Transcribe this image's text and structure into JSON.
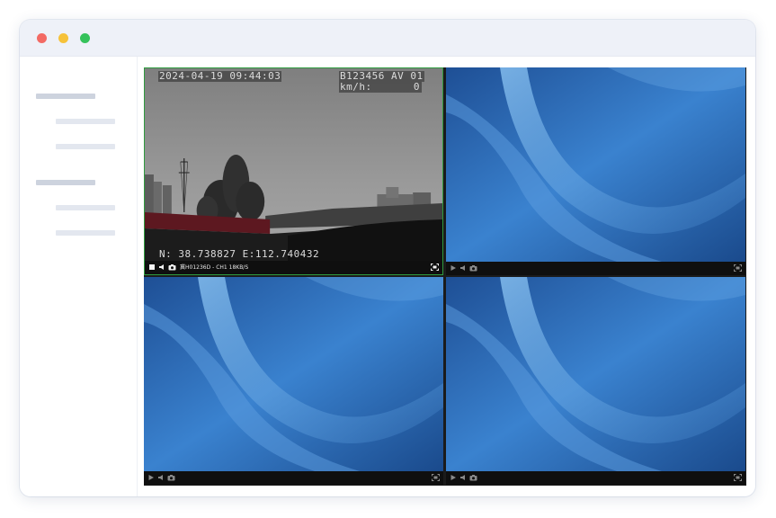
{
  "window": {
    "controls": [
      "close",
      "minimize",
      "maximize"
    ]
  },
  "video_panels": [
    {
      "state": "live",
      "osd": {
        "timestamp": "2024-04-19 09:44:03",
        "plate_channel": "B123456 AV 01",
        "speed_label": "km/h:",
        "speed_value": "0",
        "gps": "N: 38.738827 E:112.740432"
      },
      "status_label": "冀H01236D - CH1 18KB/S",
      "icons": [
        "stop-icon",
        "volume-icon",
        "camera-icon",
        "fullscreen-icon"
      ]
    },
    {
      "state": "idle",
      "icons": [
        "play-icon",
        "volume-icon",
        "camera-icon",
        "fullscreen-icon"
      ]
    },
    {
      "state": "idle",
      "icons": [
        "play-icon",
        "volume-icon",
        "camera-icon",
        "fullscreen-icon"
      ]
    },
    {
      "state": "idle",
      "icons": [
        "play-icon",
        "volume-icon",
        "camera-icon",
        "fullscreen-icon"
      ]
    }
  ],
  "colors": {
    "active_border": "#2e9b3e",
    "idle_wallpaper_blue": "#2f73c2",
    "control_bar": "#0f0f0f"
  }
}
